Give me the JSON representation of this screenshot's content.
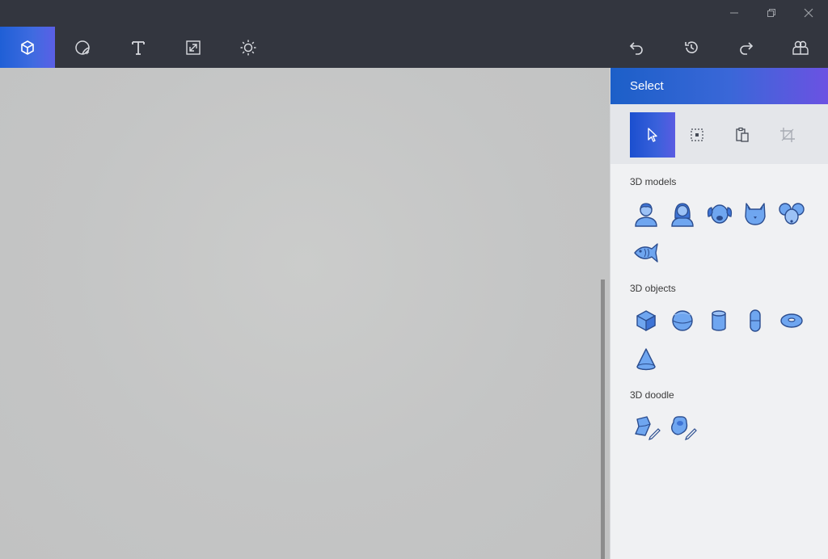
{
  "window": {
    "controls": [
      "minimize-icon",
      "restore-icon",
      "close-icon"
    ]
  },
  "toolbar": {
    "left_tools": [
      {
        "icon": "3d-shapes-icon",
        "active": true
      },
      {
        "icon": "stickers-icon",
        "active": false
      },
      {
        "icon": "text-icon",
        "active": false
      },
      {
        "icon": "canvas-icon",
        "active": false
      },
      {
        "icon": "effects-icon",
        "active": false
      }
    ],
    "right_tools": [
      "undo-icon",
      "history-icon",
      "redo-icon",
      "remix3d-icon"
    ]
  },
  "panel": {
    "title": "Select",
    "select_tools": [
      "select-pointer-icon",
      "marquee-select-icon",
      "paste-icon",
      "crop-icon"
    ],
    "sections": {
      "models": "3D models",
      "objects": "3D objects",
      "doodle": "3D doodle"
    },
    "models": [
      "man-model-icon",
      "woman-model-icon",
      "dog-model-icon",
      "cat-model-icon",
      "mouse-model-icon",
      "fish-model-icon"
    ],
    "objects": [
      "cube-icon",
      "sphere-icon",
      "cylinder-icon",
      "capsule-icon",
      "donut-icon",
      "cone-icon"
    ],
    "doodles": [
      "sharp-edge-doodle-icon",
      "soft-edge-doodle-icon"
    ]
  },
  "colors": {
    "accent": "#3f6be0",
    "shape_fill": "#6fa6f0",
    "shape_stroke": "#2b4d8f",
    "toolbar_bg": "#33363f",
    "canvas_bg": "#c4c5c5"
  }
}
